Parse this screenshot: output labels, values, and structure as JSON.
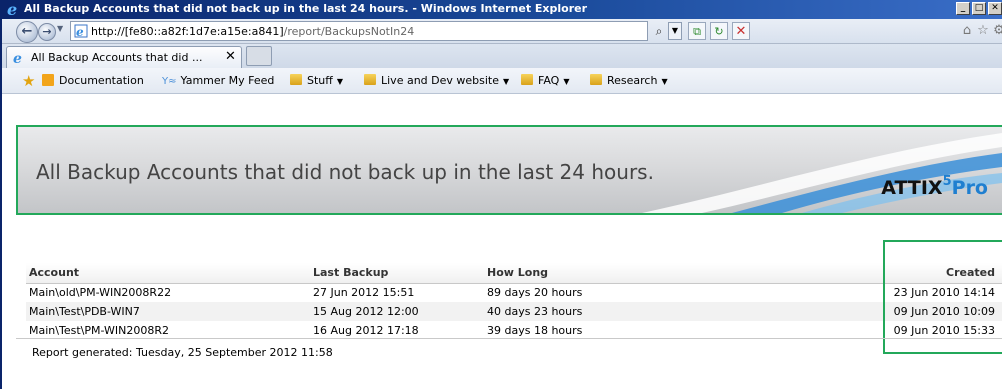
{
  "window": {
    "title": "All Backup Accounts that did not back up in the last 24 hours. - Windows Internet Explorer",
    "minimize_label": "_",
    "maximize_label": "□",
    "close_label": "✕"
  },
  "address_bar": {
    "url_host": "http://[fe80::a82f:1d7e:a15e:a841]",
    "url_path": "/report/BackupsNotIn24"
  },
  "tab": {
    "label": "All Backup Accounts that did ...",
    "close_label": "✕"
  },
  "favorites": {
    "items": [
      {
        "label": "Documentation"
      },
      {
        "label": "Yammer My Feed"
      },
      {
        "label": "Stuff"
      },
      {
        "label": "Live and Dev website"
      },
      {
        "label": "FAQ"
      },
      {
        "label": "Research"
      }
    ]
  },
  "report": {
    "title": "All Backup Accounts that did not back up in the last 24 hours.",
    "logo_text": "ATTIX",
    "logo_superscript": "5",
    "logo_suffix": "Pro",
    "columns": [
      "Account",
      "Last Backup",
      "How Long",
      "Created"
    ],
    "rows": [
      {
        "account": "Main\\old\\PM-WIN2008R22",
        "last_backup": "27 Jun 2012 15:51",
        "how_long": "89 days 20 hours",
        "created": "23 Jun 2010 14:14"
      },
      {
        "account": "Main\\Test\\PDB-WIN7",
        "last_backup": "15 Aug 2012 12:00",
        "how_long": "40 days 23 hours",
        "created": "09 Jun 2010 10:09"
      },
      {
        "account": "Main\\Test\\PM-WIN2008R2",
        "last_backup": "16 Aug 2012 17:18",
        "how_long": "39 days 18 hours",
        "created": "09 Jun 2010 15:33"
      }
    ],
    "footer": "Report generated: Tuesday, 25 September 2012 11:58"
  },
  "colors": {
    "highlight_green": "#23a85a",
    "logo_blue": "#1f7fd0",
    "titlebar_blue": "#0a246a"
  }
}
